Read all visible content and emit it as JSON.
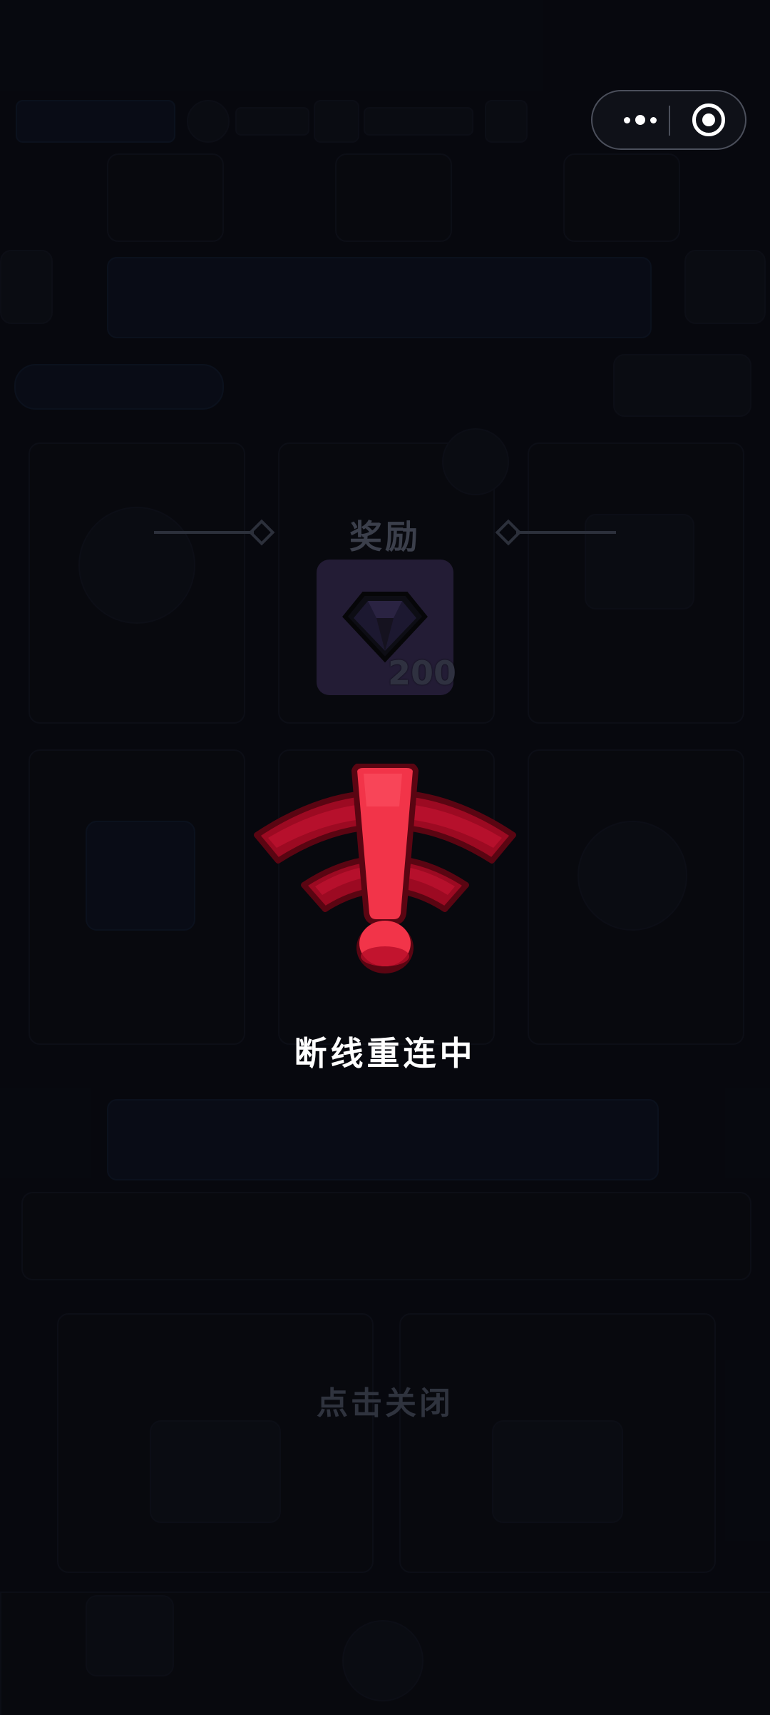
{
  "capsule": {
    "more_icon": "more-dots-icon",
    "close_icon": "target-circle-icon"
  },
  "reward": {
    "title": "奖励",
    "item_icon": "gem-icon",
    "amount": "200"
  },
  "connection": {
    "icon": "wifi-warning-icon",
    "status": "断线重连中",
    "close_hint": "点击关闭"
  },
  "colors": {
    "warning_red": "#e6233f",
    "warning_dark": "#6b0616",
    "overlay_bg": "#090b12"
  }
}
